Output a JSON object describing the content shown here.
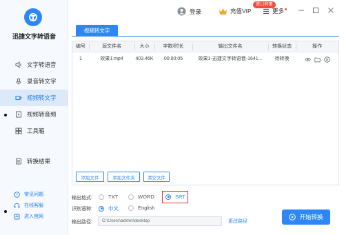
{
  "app": {
    "title": "迅捷文字转语音"
  },
  "sidebar": {
    "items": [
      {
        "label": "文字转语音",
        "icon": "speaker-icon"
      },
      {
        "label": "录音转文字",
        "icon": "microphone-icon"
      },
      {
        "label": "视频转文字",
        "icon": "video-icon",
        "active": true
      },
      {
        "label": "视频转音频",
        "icon": "film-icon"
      },
      {
        "label": "工具箱",
        "icon": "toolbox-icon"
      },
      {
        "label": "转换结果",
        "icon": "result-icon"
      }
    ],
    "bottom": [
      {
        "label": "常见问题",
        "icon": "question-icon"
      },
      {
        "label": "在线客服",
        "icon": "headset-icon"
      },
      {
        "label": "进入官网",
        "icon": "home-icon"
      }
    ]
  },
  "topbar": {
    "login": "登录",
    "vip": "充值VIP",
    "vip_badge": "双12特惠",
    "more": "更多"
  },
  "tabs": [
    {
      "label": "视频转文字"
    }
  ],
  "table": {
    "columns": [
      "编号",
      "源文件名",
      "大小",
      "字数/时长",
      "输出文件名",
      "转换状态",
      "操作"
    ],
    "rows": [
      {
        "index": "1",
        "name": "效果1.mp4",
        "size": "403.46K",
        "duration": "00:00:05",
        "output": "效果1-迅捷文字转语音-1641...",
        "status": "待转换"
      }
    ]
  },
  "buttons": {
    "add_file": "添加文件",
    "add_folder": "添加文件夹",
    "clear_files": "清空文件"
  },
  "options": {
    "format_label": "输出格式:",
    "formats": [
      "TXT",
      "WORD",
      "SRT"
    ],
    "selected_format": "SRT",
    "language_label": "识别语种:",
    "languages": [
      "中文",
      "English"
    ],
    "selected_language": "中文",
    "path_label": "输出路径:",
    "path_value": "C:\\Users\\admin\\desktop",
    "change_path": "更改路径"
  },
  "start_button": "开始转换",
  "colors": {
    "accent": "#2d88f5",
    "highlight": "#e3322a",
    "badge": "#f24a3d"
  }
}
